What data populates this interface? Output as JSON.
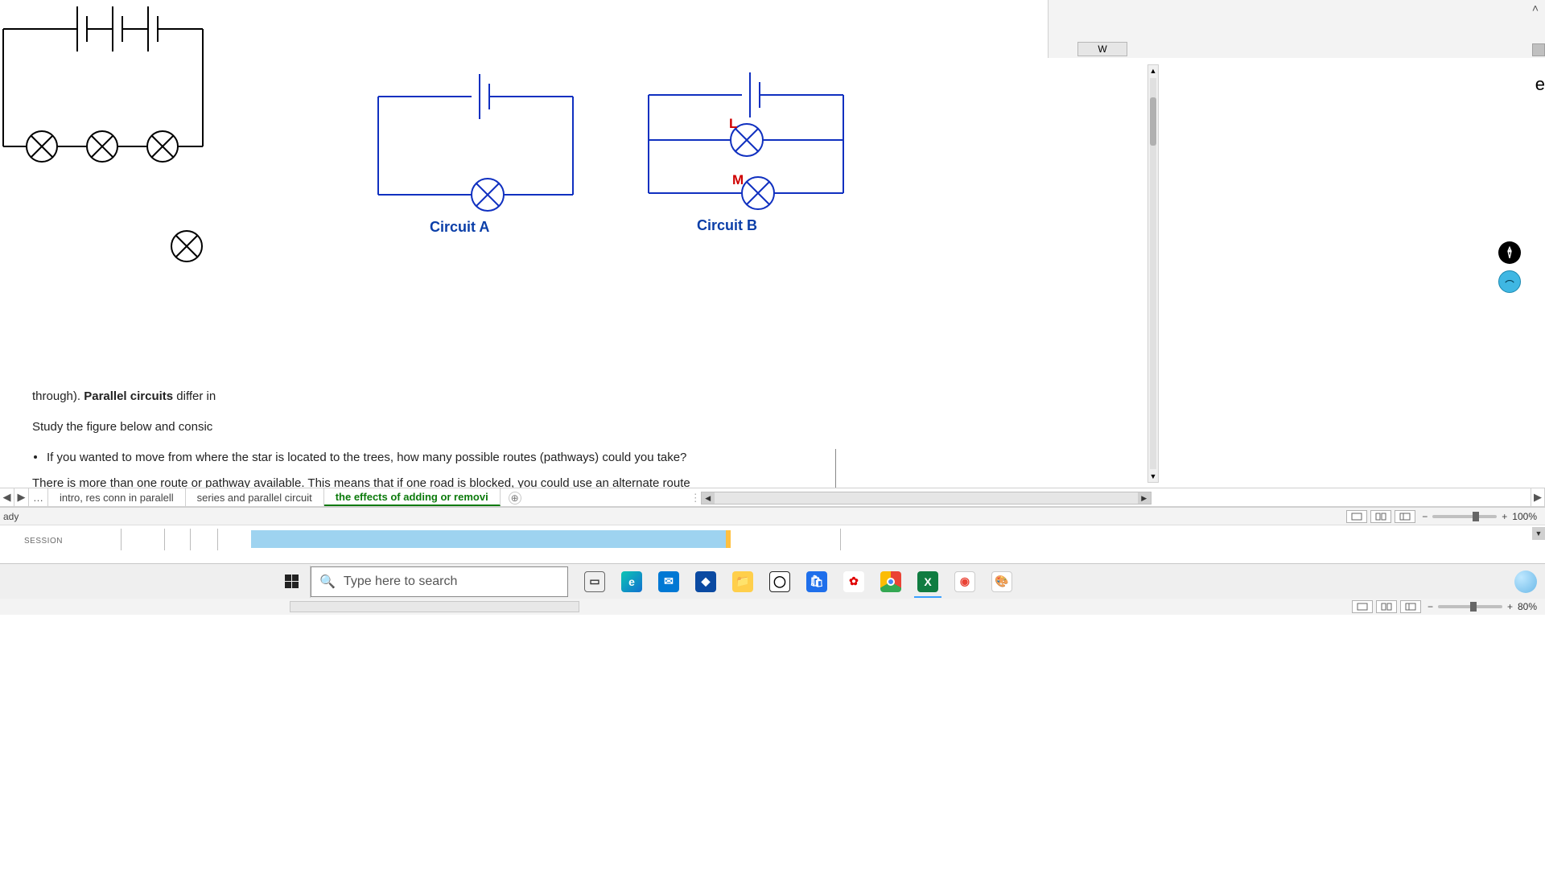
{
  "topfrag": {
    "col_header": "W",
    "collapse_glyph": "˄",
    "edge_letter": "e"
  },
  "diagram": {
    "circuitA_label": "Circuit A",
    "circuitB_label": "Circuit B",
    "bulb_L": "L",
    "bulb_M": "M"
  },
  "bodytext": {
    "line1_pre": "through). ",
    "line1_bold": "Parallel circuits",
    "line1_post": " differ in",
    "line2": "Study the figure below and consic",
    "bullet1": "If you wanted to move from where the star is located to the trees, how many possible routes (pathways) could you take?",
    "line3": "There is more than one route or pathway available. This means that if one road is blocked, you could use an alternate route"
  },
  "sheets": {
    "tab1": "intro, res conn in paralell",
    "tab2": "series and parallel circuit",
    "tab3": "the effects of adding or removi",
    "dots": "…",
    "newsheet_glyph": "⊕"
  },
  "statusbar": {
    "ready": "ady",
    "zoom1": "100%",
    "zoom2": "80%",
    "minus": "−",
    "plus": "+"
  },
  "lowerdoc": {
    "session": "SESSION"
  },
  "taskbar": {
    "search_placeholder": "Type here to search"
  }
}
